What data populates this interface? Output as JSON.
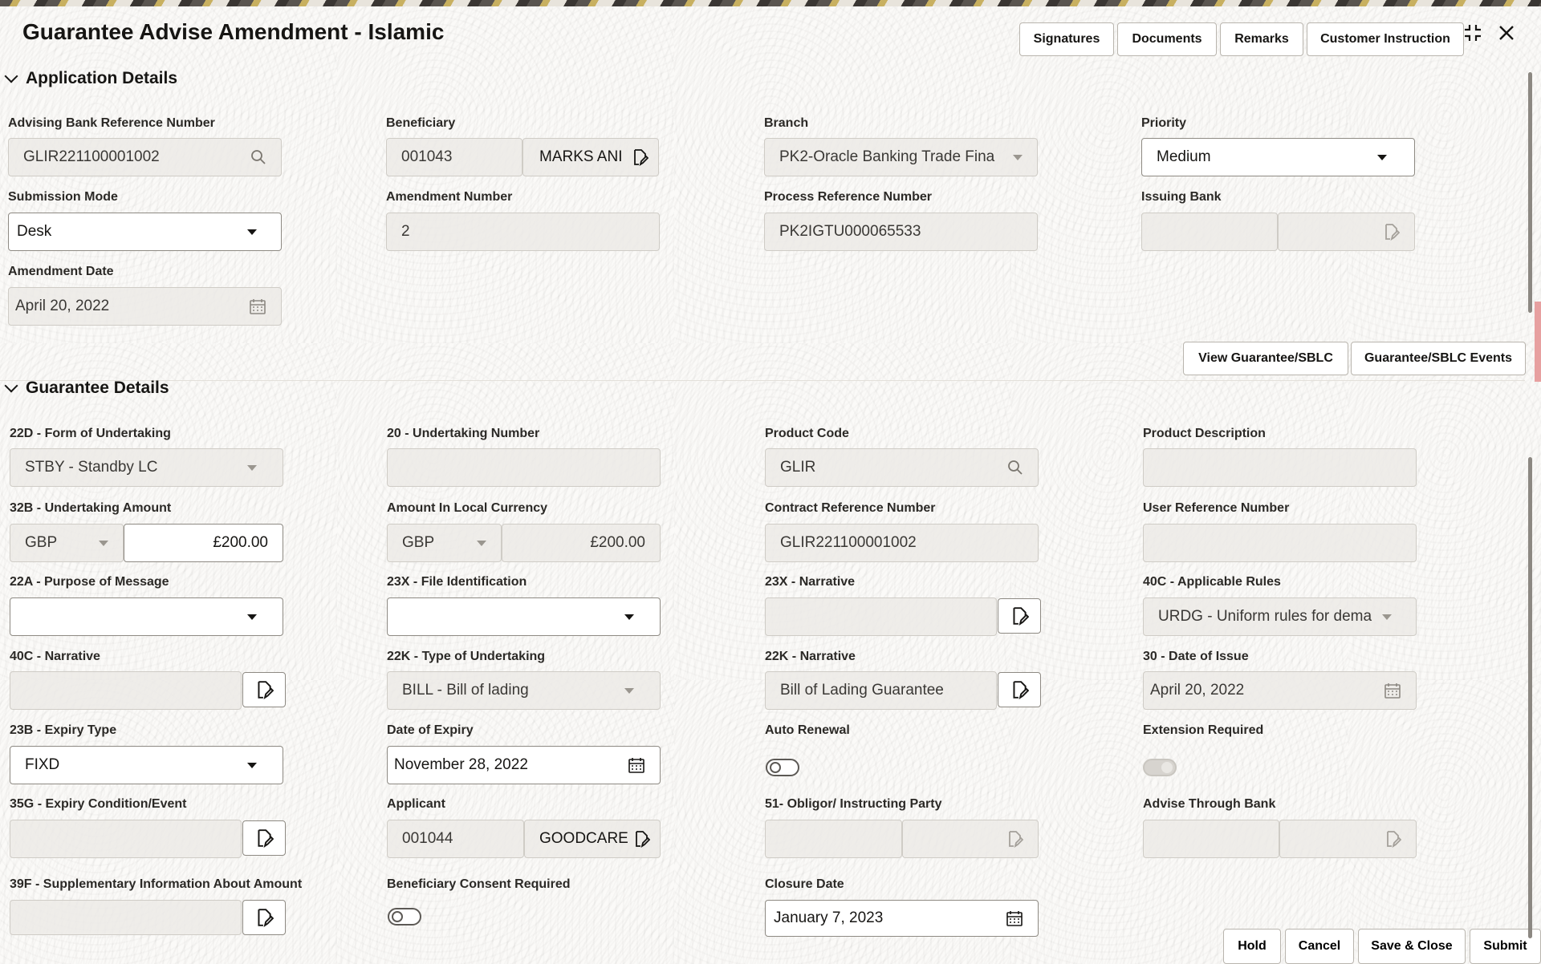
{
  "header": {
    "title": "Guarantee Advise Amendment - Islamic",
    "buttons": [
      "Signatures",
      "Documents",
      "Remarks",
      "Customer Instruction"
    ]
  },
  "application_details": {
    "section_title": "Application Details",
    "advising_bank_ref": {
      "label": "Advising Bank Reference Number",
      "value": "GLIR221100001002"
    },
    "beneficiary": {
      "label": "Beneficiary",
      "id": "001043",
      "name": "MARKS ANI"
    },
    "branch": {
      "label": "Branch",
      "value": "PK2-Oracle Banking Trade Fina"
    },
    "priority": {
      "label": "Priority",
      "value": "Medium"
    },
    "submission_mode": {
      "label": "Submission Mode",
      "value": "Desk"
    },
    "amendment_number": {
      "label": "Amendment Number",
      "value": "2"
    },
    "process_ref": {
      "label": "Process Reference Number",
      "value": "PK2IGTU000065533"
    },
    "issuing_bank": {
      "label": "Issuing Bank",
      "id": "",
      "name": ""
    },
    "amendment_date": {
      "label": "Amendment Date",
      "value": "April 20, 2022"
    },
    "view_btn": "View Guarantee/SBLC",
    "events_btn": "Guarantee/SBLC Events"
  },
  "guarantee_details": {
    "section_title": "Guarantee Details",
    "form_of_undertaking": {
      "label": "22D - Form of Undertaking",
      "value": "STBY - Standby LC"
    },
    "undertaking_number": {
      "label": "20 - Undertaking Number",
      "value": ""
    },
    "product_code": {
      "label": "Product Code",
      "value": "GLIR"
    },
    "product_description": {
      "label": "Product Description",
      "value": ""
    },
    "undertaking_amount": {
      "label": "32B - Undertaking Amount",
      "currency": "GBP",
      "amount": "£200.00"
    },
    "amount_local": {
      "label": "Amount In Local Currency",
      "currency": "GBP",
      "amount": "£200.00"
    },
    "contract_ref": {
      "label": "Contract Reference Number",
      "value": "GLIR221100001002"
    },
    "user_ref": {
      "label": "User Reference Number",
      "value": ""
    },
    "purpose_of_message": {
      "label": "22A - Purpose of Message",
      "value": ""
    },
    "file_identification": {
      "label": "23X - File Identification",
      "value": ""
    },
    "narrative_23x": {
      "label": "23X - Narrative",
      "value": ""
    },
    "applicable_rules": {
      "label": "40C - Applicable Rules",
      "value": "URDG - Uniform rules for dema"
    },
    "narrative_40c": {
      "label": "40C - Narrative",
      "value": ""
    },
    "type_of_undertaking": {
      "label": "22K - Type of Undertaking",
      "value": "BILL - Bill of lading"
    },
    "narrative_22k": {
      "label": "22K - Narrative",
      "value": "Bill of Lading Guarantee"
    },
    "date_of_issue": {
      "label": "30 - Date of Issue",
      "value": "April 20, 2022"
    },
    "expiry_type": {
      "label": "23B - Expiry Type",
      "value": "FIXD"
    },
    "date_of_expiry": {
      "label": "Date of Expiry",
      "value": "November 28, 2022"
    },
    "auto_renewal": {
      "label": "Auto Renewal",
      "on": false
    },
    "extension_required": {
      "label": "Extension Required",
      "on": false
    },
    "expiry_condition": {
      "label": "35G - Expiry Condition/Event",
      "value": ""
    },
    "applicant": {
      "label": "Applicant",
      "id": "001044",
      "name": "GOODCARE"
    },
    "obligor": {
      "label": "51- Obligor/ Instructing Party",
      "id": "",
      "name": ""
    },
    "advise_through_bank": {
      "label": "Advise Through Bank",
      "id": "",
      "name": ""
    },
    "supplementary_info": {
      "label": "39F - Supplementary Information About Amount",
      "value": ""
    },
    "beneficiary_consent": {
      "label": "Beneficiary Consent Required",
      "on": false
    },
    "closure_date": {
      "label": "Closure Date",
      "value": "January 7, 2023"
    }
  },
  "footer": {
    "hold": "Hold",
    "cancel": "Cancel",
    "save_close": "Save & Close",
    "submit": "Submit"
  },
  "icons": {
    "search": "search-icon",
    "document_edit": "document-edit-icon",
    "calendar": "calendar-icon",
    "caret": "caret-down-icon",
    "collapse": "chevron-down-icon",
    "minimize": "minimize-icon",
    "close": "close-icon"
  }
}
